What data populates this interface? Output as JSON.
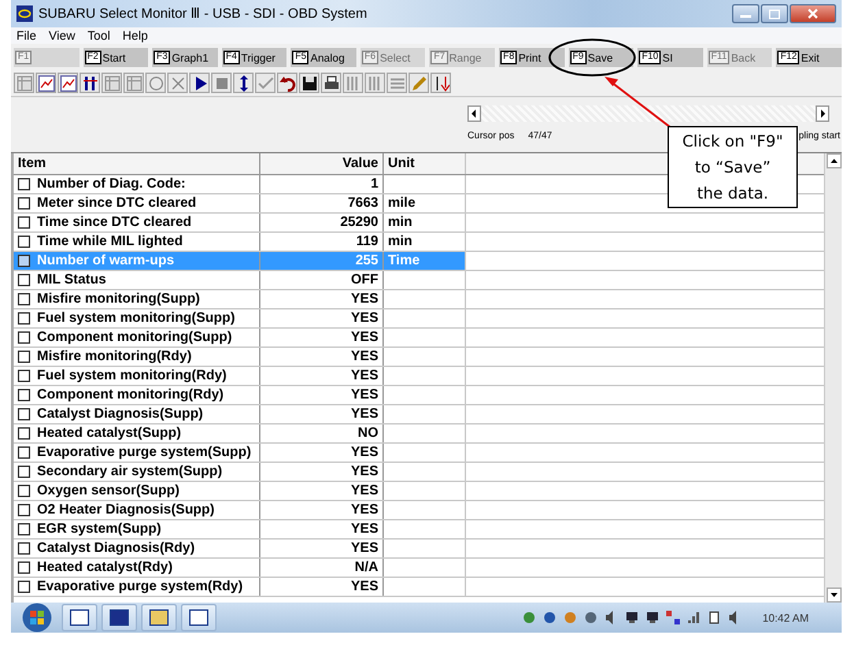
{
  "window": {
    "title": "SUBARU Select Monitor Ⅲ - USB - SDI - OBD System"
  },
  "menu": [
    "File",
    "View",
    "Tool",
    "Help"
  ],
  "function_keys": [
    {
      "key": "F1",
      "disabled": true
    },
    {
      "key": "F2",
      "label": "Start",
      "disabled": false
    },
    {
      "key": "F3",
      "label": "Graph1",
      "disabled": false
    },
    {
      "key": "F4",
      "label": "Trigger",
      "disabled": false
    },
    {
      "key": "F5",
      "label": "Analog",
      "disabled": false
    },
    {
      "key": "F6",
      "label": "Select",
      "disabled": true
    },
    {
      "key": "F7",
      "label": "Range",
      "disabled": true
    },
    {
      "key": "F8",
      "label": "Print",
      "disabled": false
    },
    {
      "key": "F9",
      "label": "Save",
      "disabled": false
    },
    {
      "key": "F10",
      "label": "SI",
      "disabled": false
    },
    {
      "key": "F11",
      "label": "Back",
      "disabled": true
    },
    {
      "key": "F12",
      "label": "Exit",
      "disabled": false
    }
  ],
  "cursor": {
    "label": "Cursor pos",
    "value": "47/47",
    "status": "pling start"
  },
  "table": {
    "columns": [
      "Item",
      "Value",
      "Unit"
    ],
    "rows": [
      {
        "item": "Number of Diag. Code:",
        "value": "1",
        "unit": "",
        "selected": false
      },
      {
        "item": "Meter since DTC cleared",
        "value": "7663",
        "unit": "mile",
        "selected": false
      },
      {
        "item": "Time since DTC cleared",
        "value": "25290",
        "unit": "min",
        "selected": false
      },
      {
        "item": "Time while MIL lighted",
        "value": "119",
        "unit": "min",
        "selected": false
      },
      {
        "item": "Number of warm-ups",
        "value": "255",
        "unit": "Time",
        "selected": true
      },
      {
        "item": "MIL Status",
        "value": "OFF",
        "unit": "",
        "selected": false
      },
      {
        "item": "Misfire monitoring(Supp)",
        "value": "YES",
        "unit": "",
        "selected": false
      },
      {
        "item": "Fuel system monitoring(Supp)",
        "value": "YES",
        "unit": "",
        "selected": false
      },
      {
        "item": "Component monitoring(Supp)",
        "value": "YES",
        "unit": "",
        "selected": false
      },
      {
        "item": "Misfire monitoring(Rdy)",
        "value": "YES",
        "unit": "",
        "selected": false
      },
      {
        "item": "Fuel system monitoring(Rdy)",
        "value": "YES",
        "unit": "",
        "selected": false
      },
      {
        "item": "Component monitoring(Rdy)",
        "value": "YES",
        "unit": "",
        "selected": false
      },
      {
        "item": "Catalyst Diagnosis(Supp)",
        "value": "YES",
        "unit": "",
        "selected": false
      },
      {
        "item": "Heated catalyst(Supp)",
        "value": "NO",
        "unit": "",
        "selected": false
      },
      {
        "item": "Evaporative purge system(Supp)",
        "value": "YES",
        "unit": "",
        "selected": false
      },
      {
        "item": "Secondary air system(Supp)",
        "value": "YES",
        "unit": "",
        "selected": false
      },
      {
        "item": "Oxygen sensor(Supp)",
        "value": "YES",
        "unit": "",
        "selected": false
      },
      {
        "item": "O2 Heater Diagnosis(Supp)",
        "value": "YES",
        "unit": "",
        "selected": false
      },
      {
        "item": "EGR system(Supp)",
        "value": "YES",
        "unit": "",
        "selected": false
      },
      {
        "item": "Catalyst Diagnosis(Rdy)",
        "value": "YES",
        "unit": "",
        "selected": false
      },
      {
        "item": "Heated catalyst(Rdy)",
        "value": "N/A",
        "unit": "",
        "selected": false
      },
      {
        "item": "Evaporative purge system(Rdy)",
        "value": "YES",
        "unit": "",
        "selected": false
      }
    ]
  },
  "callout": {
    "text": "Click on \"F9\" to “Save” the data."
  },
  "taskbar": {
    "clock": "10:42 AM"
  }
}
